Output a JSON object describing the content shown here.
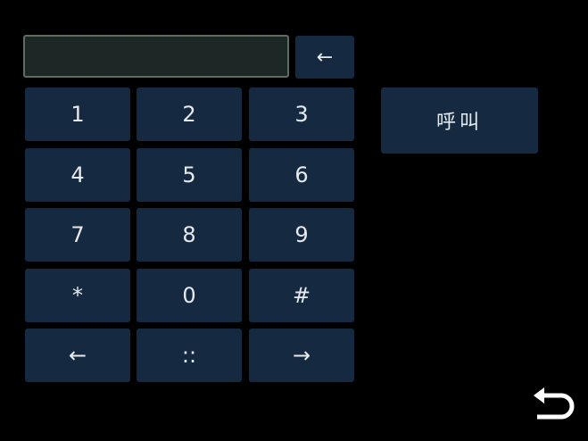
{
  "display": {
    "value": ""
  },
  "backspace": {
    "label": "←"
  },
  "keypad": {
    "keys": [
      "1",
      "2",
      "3",
      "4",
      "5",
      "6",
      "7",
      "8",
      "9",
      "*",
      "0",
      "#",
      "←",
      "::",
      "→"
    ]
  },
  "call_button": {
    "label": "呼叫"
  },
  "back_button": {
    "icon": "return-arrow-icon"
  },
  "colors": {
    "background": "#000000",
    "button": "#152a40",
    "display_fill": "#1d2826",
    "display_border": "#5c6e62",
    "text": "#e6eaee"
  }
}
